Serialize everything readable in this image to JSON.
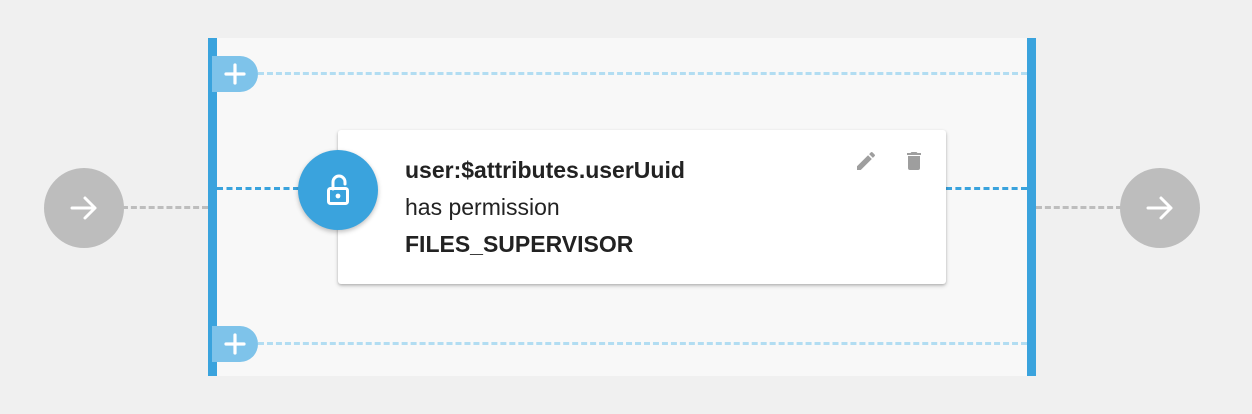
{
  "condition": {
    "subject": "user:$attributes.userUuid",
    "relation": "has permission",
    "permission": "FILES_SUPERVISOR"
  },
  "icons": {
    "entry": "arrow-right-icon",
    "exit": "arrow-right-icon",
    "condition": "lock-open-icon",
    "edit": "pencil-icon",
    "delete": "trash-icon",
    "add": "plus-icon"
  },
  "colors": {
    "accent": "#3aa3dd",
    "accent_light": "#7ec3ea",
    "lane_dash_light": "#b2ddf2",
    "node_gray": "#bdbdbd",
    "background": "#f0f0f0",
    "panel_background": "#f8f8f8",
    "action_icon": "#9e9e9e"
  }
}
